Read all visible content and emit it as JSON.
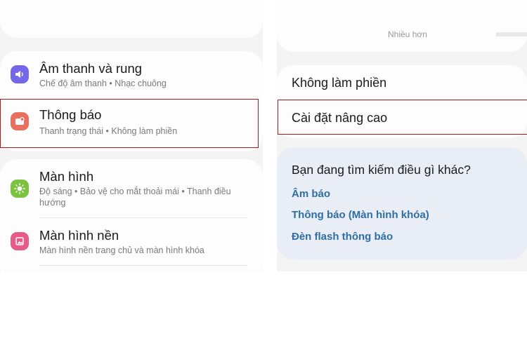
{
  "left": {
    "top_card_partial": "",
    "sound": {
      "title": "Âm thanh và rung",
      "subtitle": "Chế độ âm thanh • Nhạc chuông",
      "icon": "volume-icon",
      "icon_color": "#7468e8"
    },
    "notifications": {
      "title": "Thông báo",
      "subtitle": "Thanh trạng thái • Không làm phiền",
      "icon": "notification-icon",
      "icon_color": "#e9705e"
    },
    "display": {
      "title": "Màn hình",
      "subtitle": "Độ sáng • Bảo vệ cho mắt thoải mái • Thanh điều hướng",
      "icon": "brightness-icon",
      "icon_color": "#7cc241"
    },
    "wallpaper": {
      "title": "Màn hình nền",
      "subtitle": "Màn hình nền trang chủ và màn hình khóa",
      "icon": "wallpaper-icon",
      "icon_color": "#e65b8a"
    }
  },
  "right": {
    "top_partial_text": "Nhiều hơn",
    "do_not_disturb": "Không làm phiền",
    "advanced_settings": "Cài đặt nâng cao",
    "search_section": {
      "question": "Bạn đang tìm kiếm điều gì khác?",
      "links": [
        "Âm báo",
        "Thông báo (Màn hình khóa)",
        "Đèn flash thông báo"
      ],
      "link_color": "#2f6ea3"
    }
  },
  "highlight_color": "#a21d22"
}
